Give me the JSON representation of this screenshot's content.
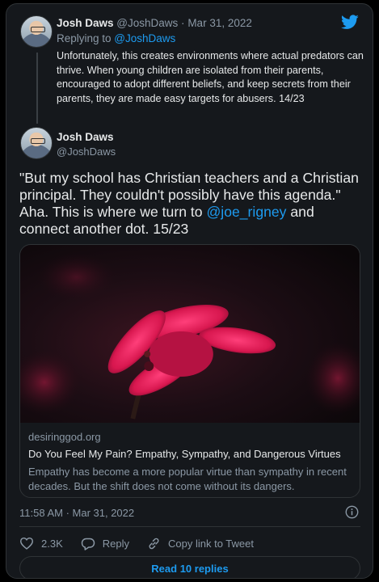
{
  "tweet_reply": {
    "name": "Josh Daws",
    "handle": "@JoshDaws",
    "date": "Mar 31, 2022",
    "replying_prefix": "Replying to ",
    "replying_handle": "@JoshDaws",
    "text": "Unfortunately, this creates environments where actual predators can thrive. When young children are isolated from their parents, encouraged to adopt different beliefs, and keep secrets from their parents, they are made easy targets for abusers. 14/23"
  },
  "tweet_main": {
    "name": "Josh Daws",
    "handle": "@JoshDaws",
    "text_before": "\"But my school has Christian teachers and a Christian principal. They couldn't possibly have this agenda.\" Aha. This is where we turn to ",
    "mention": "@joe_rigney",
    "text_after": " and connect another dot. 15/23",
    "card": {
      "domain": "desiringgod.org",
      "title": "Do You Feel My Pain? Empathy, Sympathy, and Dangerous Virtues",
      "description": "Empathy has become a more popular virtue than sympathy in recent decades. But the shift does not come without its dangers."
    },
    "timestamp": "11:58 AM · Mar 31, 2022",
    "likes": "2.3K",
    "reply_label": "Reply",
    "copy_link_label": "Copy link to Tweet",
    "read_replies_label": "Read 10 replies"
  },
  "colors": {
    "background": "#15181c",
    "accent": "#1d9bf0",
    "text": "#e7e9ea",
    "muted": "#8b98a5"
  },
  "icons": [
    "twitter-bird-icon",
    "info-icon",
    "heart-icon",
    "reply-icon",
    "link-icon"
  ]
}
